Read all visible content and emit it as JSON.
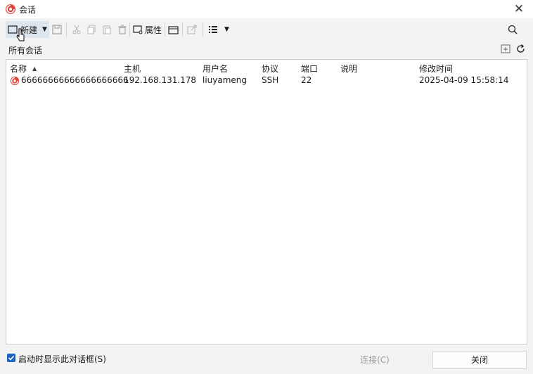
{
  "window": {
    "title": "会话",
    "close_glyph": "✕"
  },
  "toolbar": {
    "new_label": "新建",
    "properties_label": "属性",
    "icons": [
      "new-session-icon",
      "save-icon",
      "cut-icon",
      "copy-icon",
      "paste-icon",
      "delete-icon",
      "properties-icon",
      "open-folder-icon",
      "export-icon",
      "list-view-icon",
      "search-icon"
    ]
  },
  "path": {
    "label": "所有会话"
  },
  "table": {
    "columns": [
      "名称",
      "主机",
      "用户名",
      "协议",
      "端口",
      "说明",
      "修改时间"
    ],
    "sort_indicator": "▲",
    "rows": [
      {
        "name": "66666666666666666666",
        "host": "192.168.131.178",
        "user": "liuyameng",
        "protocol": "SSH",
        "port": "22",
        "description": "",
        "modified": "2025-04-09 15:58:14"
      }
    ]
  },
  "footer": {
    "show_on_startup_label": "启动时显示此对话框(S)",
    "show_on_startup_checked": true,
    "connect_label": "连接(C)",
    "close_label": "关闭"
  },
  "colors": {
    "accent": "#1e63c2",
    "brand_icon": "#e0453a",
    "new_button_bg": "#dde5ee"
  }
}
